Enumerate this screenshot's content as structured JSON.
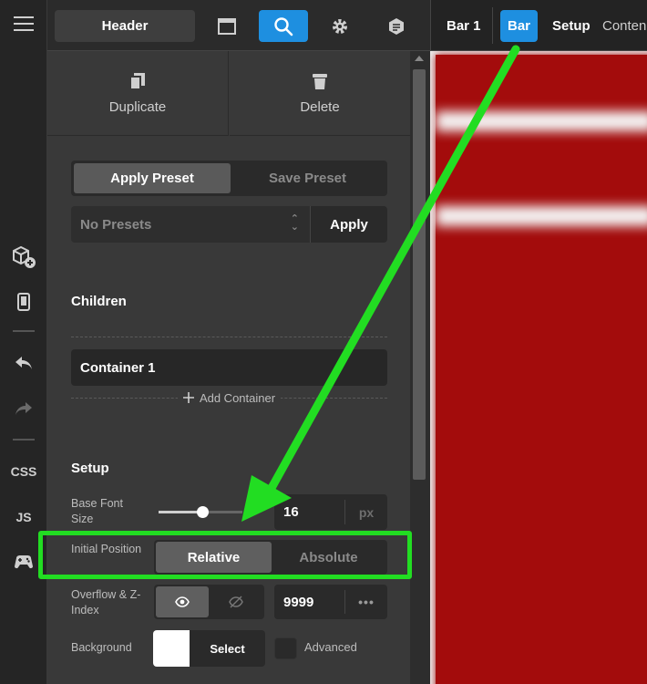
{
  "rail": {
    "css_label": "CSS",
    "js_label": "JS"
  },
  "topbar": {
    "header_label": "Header"
  },
  "right_tabs": {
    "items": [
      "Bar 1",
      "Bar",
      "Setup",
      "Conten"
    ]
  },
  "actions": {
    "duplicate_label": "Duplicate",
    "delete_label": "Delete"
  },
  "presets": {
    "apply_tab": "Apply Preset",
    "save_tab": "Save Preset",
    "select_value": "No Presets",
    "apply_button": "Apply"
  },
  "children": {
    "title": "Children",
    "items": [
      "Container 1"
    ],
    "add_label": "Add Container"
  },
  "setup": {
    "title": "Setup",
    "font_size": {
      "label": "Base Font Size",
      "value": "16",
      "unit": "px",
      "slider_fraction": 0.52
    },
    "position": {
      "label": "Initial Position",
      "options": [
        "Relative",
        "Absolute"
      ],
      "selected": "Relative"
    },
    "overflow": {
      "label": "Overflow & Z-Index",
      "visible": true,
      "z_index": "9999",
      "more": "•••"
    },
    "background": {
      "label": "Background",
      "color": "#ffffff",
      "select_label": "Select",
      "advanced_label": "Advanced"
    }
  },
  "colors": {
    "accent": "#1e8fe0",
    "annotation": "#22dd22",
    "canvas_fill": "#a30c0c"
  }
}
